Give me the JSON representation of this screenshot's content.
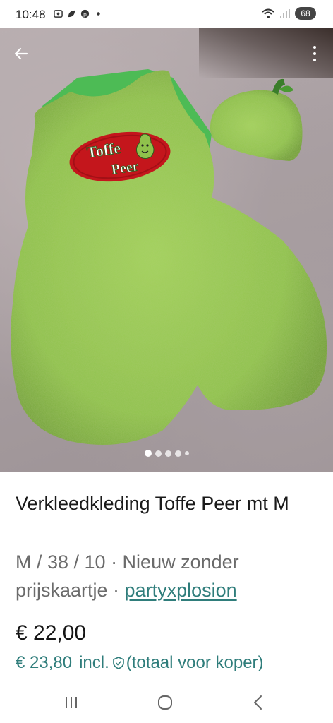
{
  "status_bar": {
    "time": "10:48",
    "left_icons": [
      "screenshot-icon",
      "leaf-icon",
      "pinterest-icon",
      "notification-dot-icon"
    ],
    "right_icons": [
      "wifi-icon",
      "signal-icon"
    ],
    "battery": "68"
  },
  "gallery": {
    "image_count": 5,
    "active_index": 0,
    "costume_logo_line1": "Toffe",
    "costume_logo_line2": "Peer"
  },
  "toolbar": {
    "back_icon": "arrow-left-icon",
    "more_icon": "more-vertical-icon"
  },
  "listing": {
    "title": "Verkleedkleding Toffe Peer mt M",
    "details": "M / 38 / 10 · Nieuw zonder prijskaartje · ",
    "seller": "partyxplosion",
    "price": "€ 22,00",
    "price_incl_amount": "€ 23,80",
    "price_incl_label": "incl.",
    "price_incl_note": "(totaal voor koper)"
  },
  "colors": {
    "accent": "#2f7d7b",
    "costume_green": "#93c84e",
    "logo_red": "#c4161c"
  },
  "navbar": {
    "icons": [
      "recent-apps-icon",
      "home-icon",
      "back-icon"
    ]
  }
}
